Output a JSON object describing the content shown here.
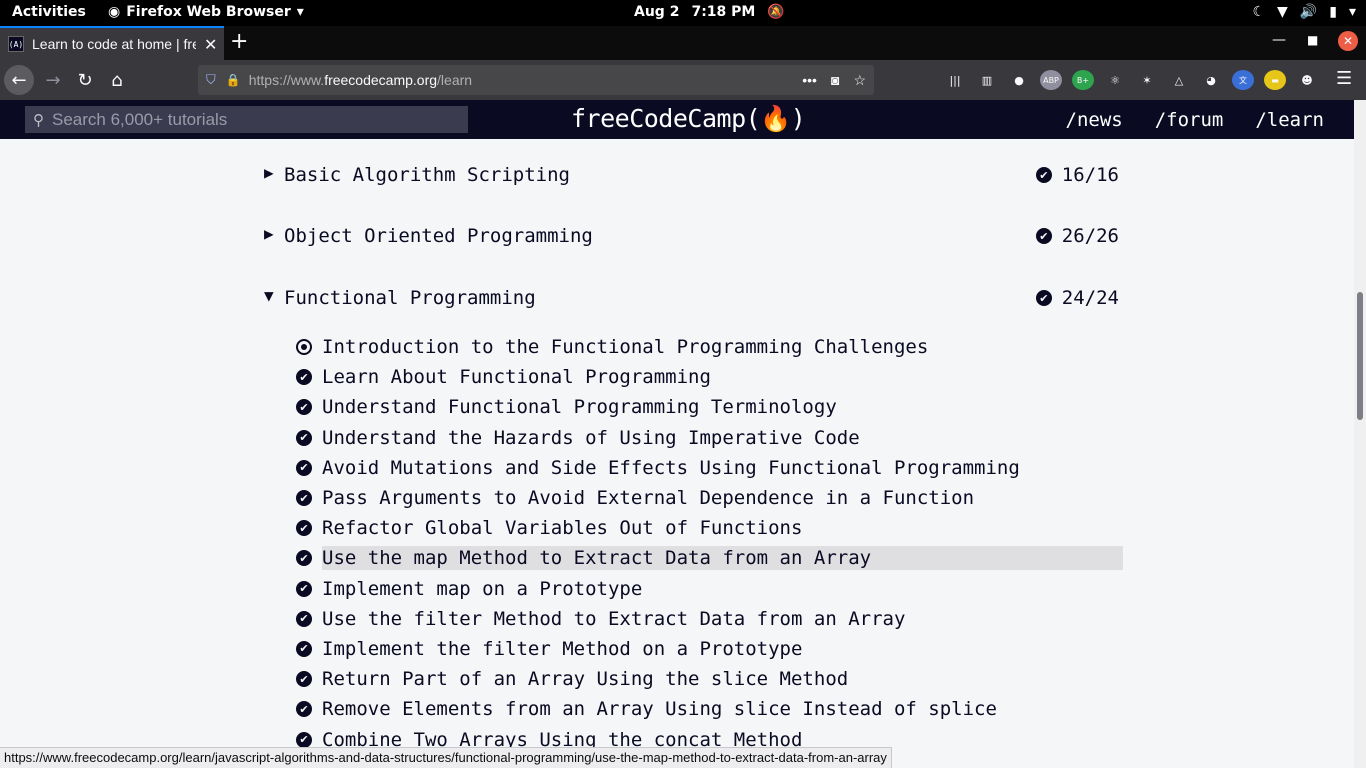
{
  "system_bar": {
    "activities": "Activities",
    "app_name": "Firefox Web Browser",
    "date": "Aug 2",
    "time": "7:18 PM"
  },
  "browser": {
    "tab_title": "Learn to code at home | fre",
    "favicon_text": "(A)",
    "url_prefix": "https://www.",
    "url_host": "freecodecamp.org",
    "url_path": "/learn",
    "status_url": "https://www.freecodecamp.org/learn/javascript-algorithms-and-data-structures/functional-programming/use-the-map-method-to-extract-data-from-an-array"
  },
  "toolbar_icons": [
    "library-icon",
    "reader-view-icon",
    "account-icon",
    "adblock-plus-icon",
    "bplus-icon",
    "react-devtools-icon",
    "octopus-extension-icon",
    "triangle-extension-icon",
    "owl-extension-icon",
    "translate-icon",
    "yellow-extension-icon",
    "ghost-extension-icon"
  ],
  "fcc": {
    "search_placeholder": "Search 6,000+ tutorials",
    "logo": "freeCodeCamp(🔥)",
    "nav": [
      "/news",
      "/forum",
      "/learn"
    ]
  },
  "blocks": [
    {
      "name": "Basic Algorithm Scripting",
      "progress": "16/16",
      "expanded": false
    },
    {
      "name": "Object Oriented Programming",
      "progress": "26/26",
      "expanded": false
    },
    {
      "name": "Functional Programming",
      "progress": "24/24",
      "expanded": true
    }
  ],
  "challenges": [
    {
      "title": "Introduction to the Functional Programming Challenges",
      "status": "intro"
    },
    {
      "title": "Learn About Functional Programming",
      "status": "done"
    },
    {
      "title": "Understand Functional Programming Terminology",
      "status": "done"
    },
    {
      "title": "Understand the Hazards of Using Imperative Code",
      "status": "done"
    },
    {
      "title": "Avoid Mutations and Side Effects Using Functional Programming",
      "status": "done"
    },
    {
      "title": "Pass Arguments to Avoid External Dependence in a Function",
      "status": "done"
    },
    {
      "title": "Refactor Global Variables Out of Functions",
      "status": "done"
    },
    {
      "title": "Use the map Method to Extract Data from an Array",
      "status": "done",
      "hovered": true
    },
    {
      "title": "Implement map on a Prototype",
      "status": "done"
    },
    {
      "title": "Use the filter Method to Extract Data from an Array",
      "status": "done"
    },
    {
      "title": "Implement the filter Method on a Prototype",
      "status": "done"
    },
    {
      "title": "Return Part of an Array Using the slice Method",
      "status": "done"
    },
    {
      "title": "Remove Elements from an Array Using slice Instead of splice",
      "status": "done"
    },
    {
      "title": "Combine Two Arrays Using the concat Method",
      "status": "done"
    }
  ],
  "colors": {
    "fcc_navy": "#0a0a23",
    "page_bg": "#f5f6f7",
    "hover_bg": "#dfdfe2"
  }
}
